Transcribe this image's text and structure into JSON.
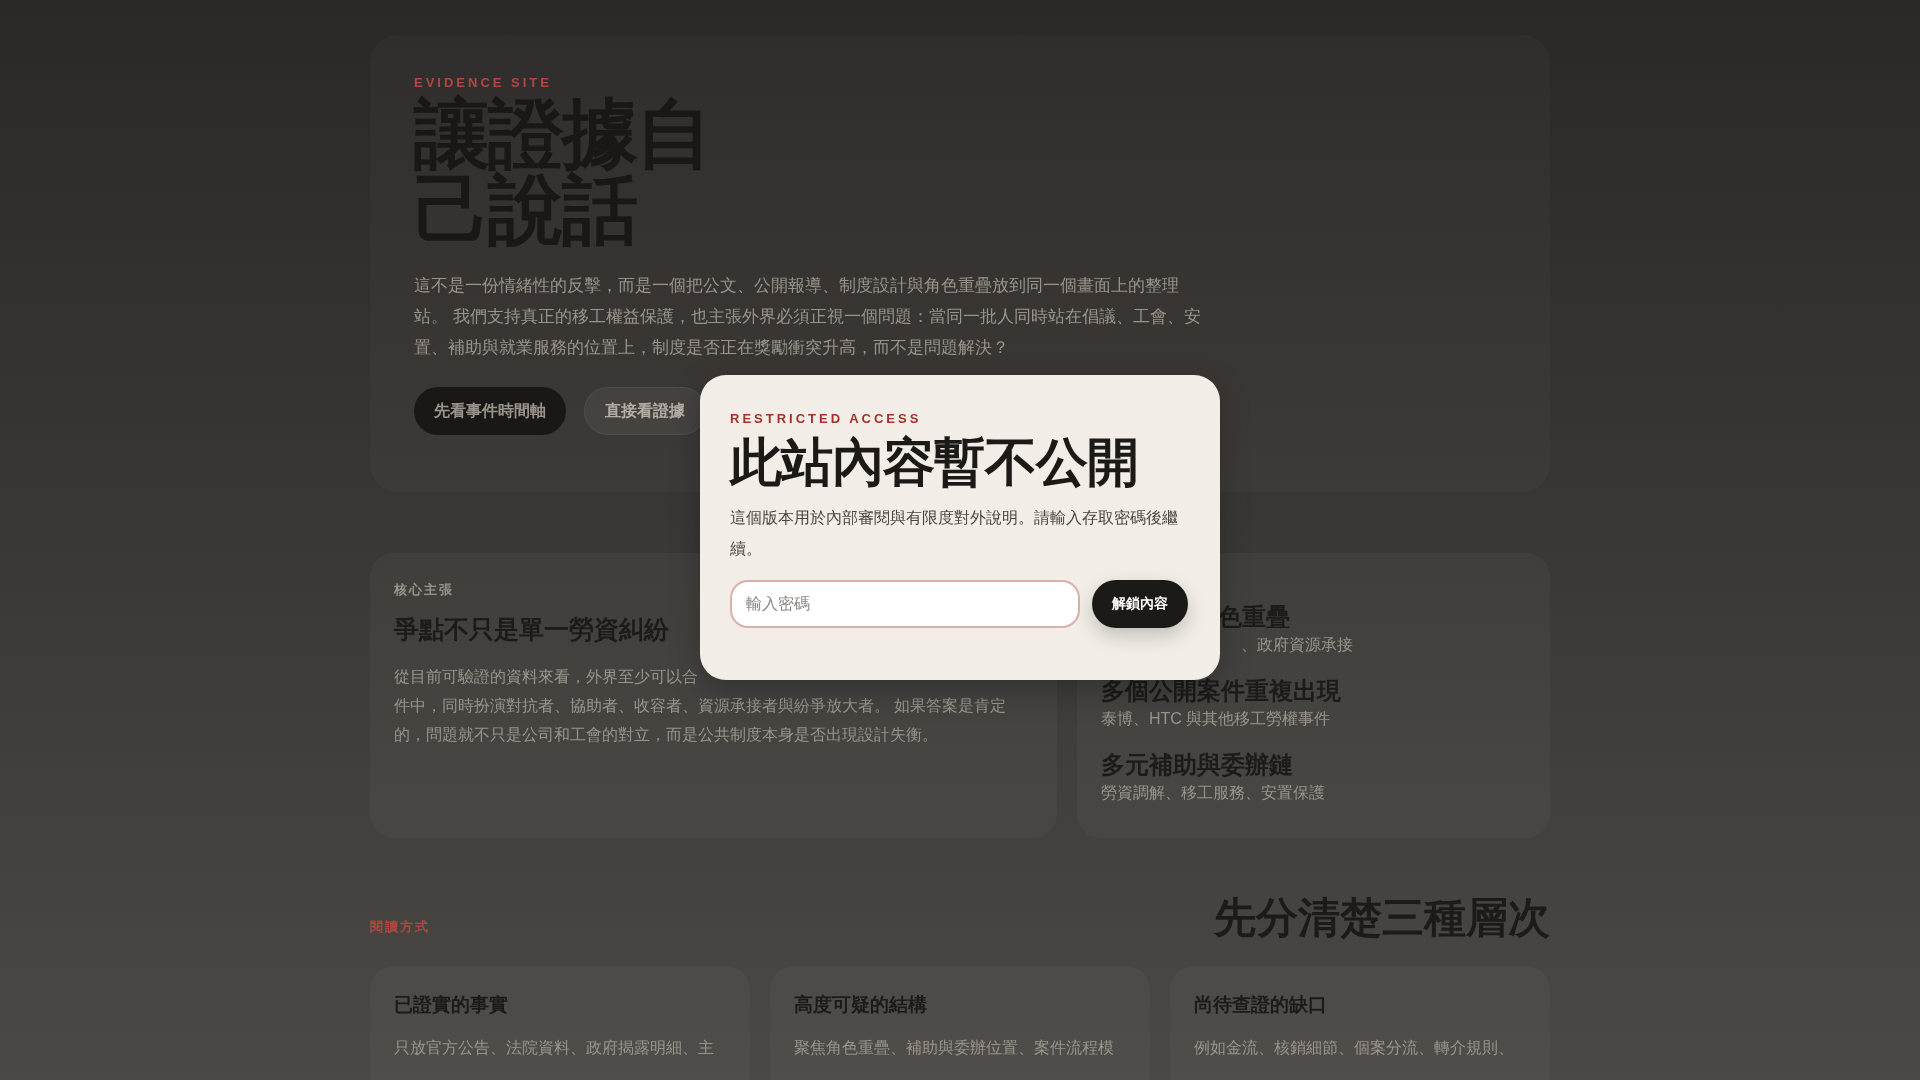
{
  "hero": {
    "eyebrow": "EVIDENCE SITE",
    "title": "讓證據自己說話",
    "text": "這不是一份情緒性的反擊，而是一個把公文、公開報導、制度設計與角色重疊放到同一個畫面上的整理站。 我們支持真正的移工權益保護，也主張外界必須正視一個問題：當同一批人同時站在倡議、工會、安置、補助與就業服務的位置上，制度是否正在獎勵衝突升高，而不是問題解決？",
    "buttons": [
      {
        "label": "先看事件時間軸",
        "kind": "primary"
      },
      {
        "label": "直接看證據",
        "kind": "secondary"
      }
    ]
  },
  "core": {
    "eyebrow": "核心主張",
    "title": "爭點不只是單一勞資糾紛",
    "lines": [
      "從目前可驗證的資料來看，外界至少可以合",
      "件中，同時扮演對抗者、協助者、收容者、資源承接者與紛爭放大者。 如果答案是肯定",
      "的，問題就不只是公司和工會的對立，而是公共制度本身是否出現設計失衡。"
    ]
  },
  "highlights": [
    {
      "kind": "partial",
      "title": "色重疊",
      "subtitle": "、政府資源承接"
    },
    {
      "kind": "full",
      "title": "多個公開案件重複出現",
      "subtitle": "泰博、HTC 與其他移工勞權事件"
    },
    {
      "kind": "full",
      "title": "多元補助與委辦鏈",
      "subtitle": "勞資調解、移工服務、安置保護"
    }
  ],
  "reading": {
    "eyebrow": "閱讀方式",
    "title": "先分清楚三種層次",
    "cards": [
      {
        "title": "已證實的事實",
        "text": "只放官方公告、法院資料、政府揭露明細、主"
      },
      {
        "title": "高度可疑的結構",
        "text": "聚焦角色重疊、補助與委辦位置、案件流程模"
      },
      {
        "title": "尚待查證的缺口",
        "text": "例如金流、核銷細節、個案分流、轉介規則、"
      }
    ]
  },
  "modal": {
    "eyebrow": "RESTRICTED ACCESS",
    "title": "此站內容暫不公開",
    "text": "這個版本用於內部審閱與有限度對外說明。請輸入存取密碼後繼續。",
    "placeholder": "輸入密碼",
    "button": "解鎖內容"
  }
}
